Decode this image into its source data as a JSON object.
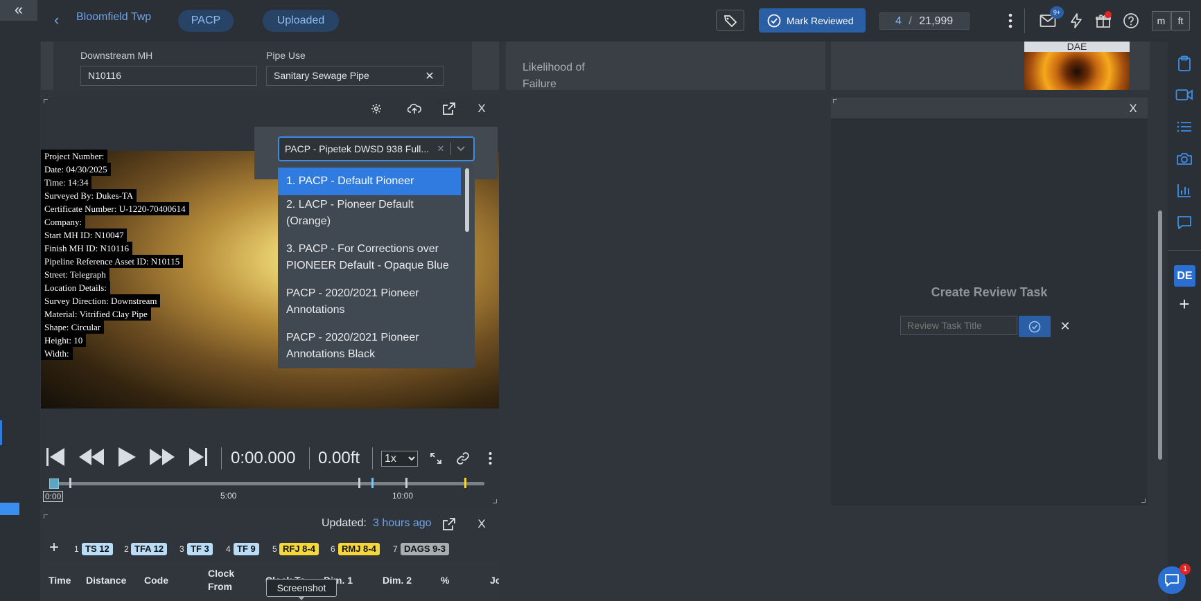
{
  "header": {
    "project": "Bloomfield Twp",
    "pills": [
      "PACP",
      "Uploaded"
    ],
    "mark_reviewed": "Mark Reviewed",
    "record_index": "4",
    "record_sep": "/",
    "record_total": "21,999",
    "mail_badge": "9+",
    "user_initials": [
      "m",
      "ft"
    ]
  },
  "fields": {
    "downstream_label": "Downstream MH",
    "downstream_value": "N10116",
    "pipe_use_label": "Pipe Use",
    "pipe_use_value": "Sanitary Sewage Pipe"
  },
  "likelihood": {
    "label": "Likelihood of Failure"
  },
  "thumbnail": {
    "label": "DAE"
  },
  "video_overlay": [
    "Project Number:",
    "Date: 04/30/2025",
    "Time: 14:34",
    "Surveyed By: Dukes-TA",
    "Certificate Number: U-1220-70400614",
    "Company:",
    "Start MH ID: N10047",
    "Finish MH ID: N10116",
    "Pipeline Reference Asset ID: N10115",
    "Street: Telegraph",
    "Location Details:",
    "Survey Direction: Downstream",
    "Material: Vitrified Clay Pipe",
    "Shape: Circular",
    "Height: 10",
    "Width:"
  ],
  "overlay_dropdown": {
    "selected": "PACP - Pipetek DWSD 938 Full...",
    "options": [
      "1. PACP - Default Pioneer",
      "2. LACP - Pioneer Default (Orange)",
      "3. PACP - For Corrections over PIONEER Default - Opaque Blue",
      "PACP - 2020/2021 Pioneer Annotations",
      "PACP - 2020/2021 Pioneer Annotations Black"
    ],
    "highlighted_index": 0
  },
  "player": {
    "time": "0:00.000",
    "distance": "0.00ft",
    "speed": "1x",
    "speed_options": [
      "1x"
    ],
    "timeline_labels": [
      "0:00",
      "5:00",
      "10:00"
    ],
    "progress_fraction": 0.0
  },
  "codes_panel": {
    "updated_label": "Updated:",
    "updated_value": "3 hours ago",
    "chips": [
      {
        "num": "1",
        "code": "TS 12",
        "color": "#b9dcf7"
      },
      {
        "num": "2",
        "code": "TFA 12",
        "color": "#b9dcf7"
      },
      {
        "num": "3",
        "code": "TF 3",
        "color": "#b9dcf7"
      },
      {
        "num": "4",
        "code": "TF 9",
        "color": "#b9dcf7"
      },
      {
        "num": "5",
        "code": "RFJ 8-4",
        "color": "#f5d73a"
      },
      {
        "num": "6",
        "code": "RMJ 8-4",
        "color": "#f5d73a"
      },
      {
        "num": "7",
        "code": "DAGS 9-3",
        "color": "#a8adb2"
      }
    ],
    "columns": [
      "Time",
      "Distance",
      "Code",
      "Clock From",
      "Clock To",
      "Dim. 1",
      "Dim. 2",
      "%",
      "Jo"
    ]
  },
  "tooltip": "Screenshot",
  "review": {
    "title": "Create Review Task",
    "placeholder": "Review Task Title"
  },
  "sidebar": {
    "badge": "DE"
  },
  "chat": {
    "badge": "1"
  },
  "colors": {
    "accent": "#2a5ea5",
    "link": "#6fa3e8",
    "badge_red": "#e02424"
  }
}
